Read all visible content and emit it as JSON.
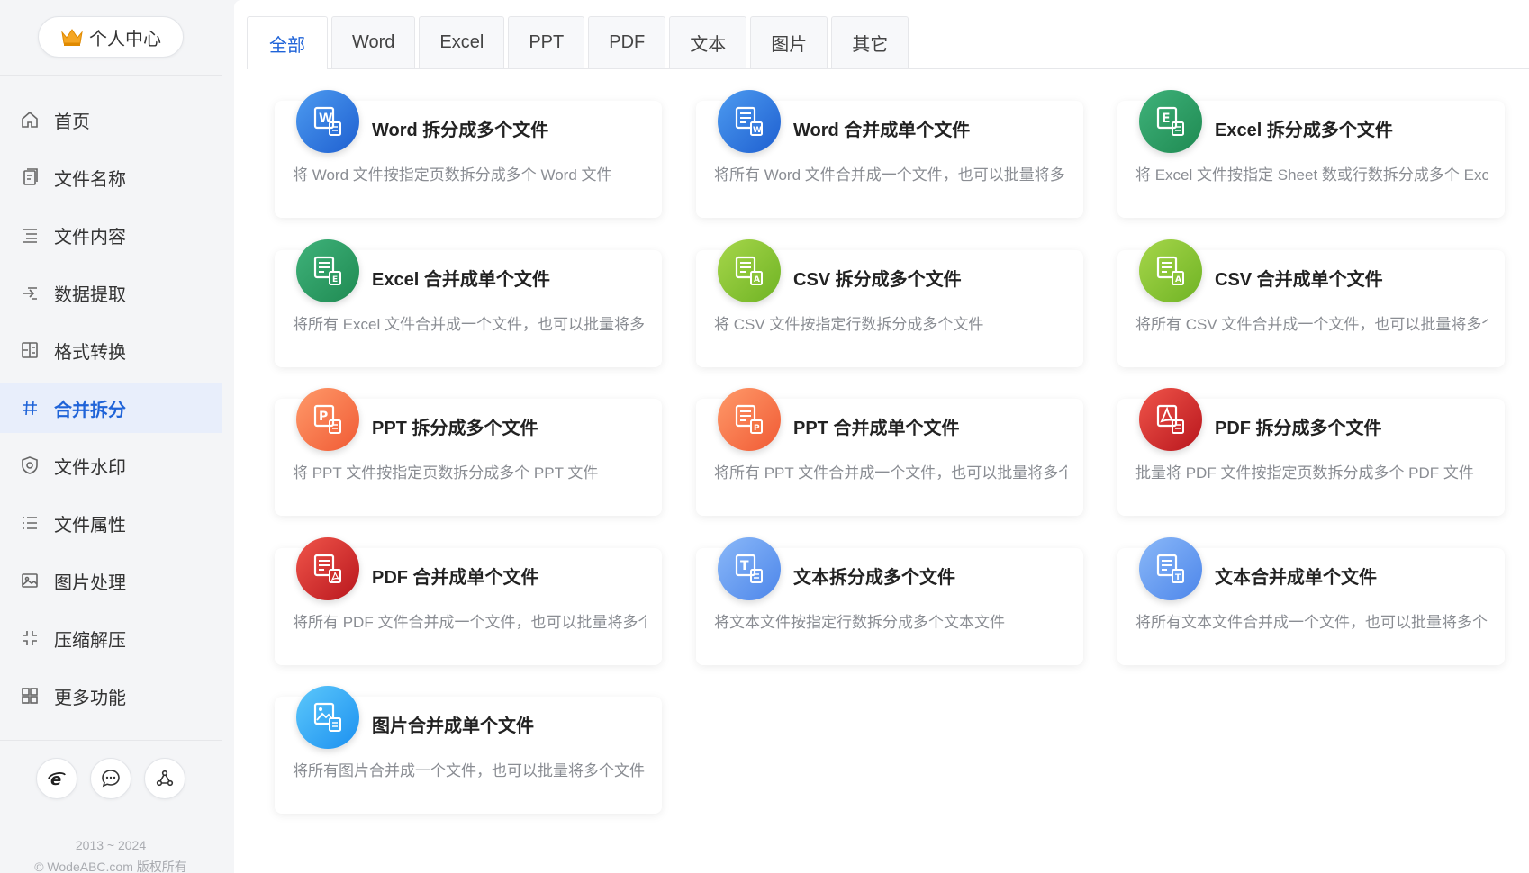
{
  "sidebar": {
    "profile_label": "个人中心",
    "items": [
      {
        "label": "首页",
        "icon": "home-icon"
      },
      {
        "label": "文件名称",
        "icon": "file-name-icon"
      },
      {
        "label": "文件内容",
        "icon": "file-content-icon"
      },
      {
        "label": "数据提取",
        "icon": "data-extract-icon"
      },
      {
        "label": "格式转换",
        "icon": "format-convert-icon"
      },
      {
        "label": "合并拆分",
        "icon": "merge-split-icon",
        "active": true
      },
      {
        "label": "文件水印",
        "icon": "watermark-icon"
      },
      {
        "label": "文件属性",
        "icon": "properties-icon"
      },
      {
        "label": "图片处理",
        "icon": "image-icon"
      },
      {
        "label": "压缩解压",
        "icon": "compress-icon"
      },
      {
        "label": "更多功能",
        "icon": "more-icon"
      }
    ],
    "footer_buttons": [
      "browser-icon",
      "chat-icon",
      "share-icon"
    ],
    "copyright_years": "2013 ~ 2024",
    "copyright_text": "© WodeABC.com 版权所有"
  },
  "tabs": [
    "全部",
    "Word",
    "Excel",
    "PPT",
    "PDF",
    "文本",
    "图片",
    "其它"
  ],
  "active_tab": "全部",
  "colors": {
    "accent": "#1f63d8",
    "active_nav_bg": "#e8eefb"
  },
  "cards": [
    {
      "title": "Word 拆分成多个文件",
      "desc": "将 Word 文件按指定页数拆分成多个 Word 文件",
      "color": "blue",
      "icon": "word-split-icon"
    },
    {
      "title": "Word 合并成单个文件",
      "desc": "将所有 Word 文件合并成一个文件，也可以批量将多",
      "color": "blue",
      "icon": "word-merge-icon"
    },
    {
      "title": "Excel 拆分成多个文件",
      "desc": "将 Excel 文件按指定 Sheet 数或行数拆分成多个 Exc",
      "color": "green",
      "icon": "excel-split-icon"
    },
    {
      "title": "Excel 合并成单个文件",
      "desc": "将所有 Excel 文件合并成一个文件，也可以批量将多",
      "color": "green",
      "icon": "excel-merge-icon"
    },
    {
      "title": "CSV 拆分成多个文件",
      "desc": "将 CSV 文件按指定行数拆分成多个文件",
      "color": "lime",
      "icon": "csv-split-icon"
    },
    {
      "title": "CSV 合并成单个文件",
      "desc": "将所有 CSV 文件合并成一个文件，也可以批量将多个",
      "color": "lime",
      "icon": "csv-merge-icon"
    },
    {
      "title": "PPT 拆分成多个文件",
      "desc": "将 PPT 文件按指定页数拆分成多个 PPT 文件",
      "color": "orange",
      "icon": "ppt-split-icon"
    },
    {
      "title": "PPT 合并成单个文件",
      "desc": "将所有 PPT 文件合并成一个文件，也可以批量将多个",
      "color": "orange",
      "icon": "ppt-merge-icon"
    },
    {
      "title": "PDF 拆分成多个文件",
      "desc": "批量将 PDF 文件按指定页数拆分成多个 PDF 文件",
      "color": "red",
      "icon": "pdf-split-icon"
    },
    {
      "title": "PDF 合并成单个文件",
      "desc": "将所有 PDF 文件合并成一个文件，也可以批量将多个",
      "color": "red",
      "icon": "pdf-merge-icon"
    },
    {
      "title": "文本拆分成多个文件",
      "desc": "将文本文件按指定行数拆分成多个文本文件",
      "color": "sky",
      "icon": "text-split-icon"
    },
    {
      "title": "文本合并成单个文件",
      "desc": "将所有文本文件合并成一个文件，也可以批量将多个",
      "color": "sky",
      "icon": "text-merge-icon"
    },
    {
      "title": "图片合并成单个文件",
      "desc": "将所有图片合并成一个文件，也可以批量将多个文件",
      "color": "cyan",
      "icon": "image-merge-icon"
    }
  ]
}
